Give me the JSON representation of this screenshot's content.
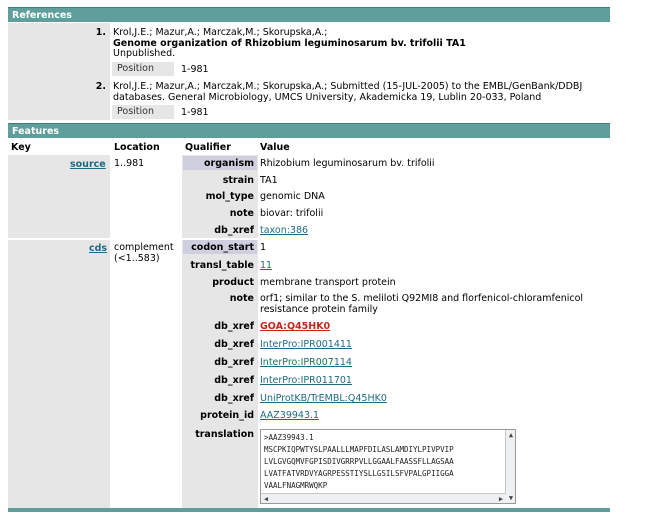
{
  "references": {
    "header": "References",
    "items": [
      {
        "num": "1.",
        "authors": "Krol,J.E.; Mazur,A.; Marczak,M.; Skorupska,A.;",
        "title": "Genome organization of Rhizobium leguminosarum bv. trifolii TA1",
        "journal": "Unpublished.",
        "position_label": "Position",
        "position_value": "1-981"
      },
      {
        "num": "2.",
        "line1": "Krol,J.E.; Mazur,A.; Marczak,M.; Skorupska,A.; Submitted (15-JUL-2005) to the EMBL/GenBank/DDBJ",
        "line2": "databases. General Microbiology, UMCS University, Akademicka 19, Lublin 20-033, Poland",
        "position_label": "Position",
        "position_value": "1-981"
      }
    ]
  },
  "features": {
    "header": "Features",
    "columns": {
      "key": "Key",
      "location": "Location",
      "qualifier": "Qualifier",
      "value": "Value"
    },
    "source": {
      "key": "source",
      "location": "1..981",
      "rows": [
        {
          "q": "organism",
          "v": "Rhizobium leguminosarum bv. trifolii"
        },
        {
          "q": "strain",
          "v": "TA1"
        },
        {
          "q": "mol_type",
          "v": "genomic DNA"
        },
        {
          "q": "note",
          "v": "biovar: trifolii"
        },
        {
          "q": "db_xref",
          "v": "taxon:386"
        }
      ]
    },
    "cds": {
      "key": "cds",
      "location1": "complement",
      "location2": "(<1..583)",
      "rows": [
        {
          "q": "codon_start",
          "v": "1"
        },
        {
          "q": "transl_table",
          "v": "11"
        },
        {
          "q": "product",
          "v": "membrane transport protein"
        },
        {
          "q": "note",
          "v1": "orf1; similar to the S. meliloti Q92MI8 and florfenicol-chloramfenicol",
          "v2": "resistance protein family"
        },
        {
          "q": "db_xref",
          "v": "GOA:Q45HK0"
        },
        {
          "q": "db_xref",
          "v": "InterPro:IPR001411"
        },
        {
          "q": "db_xref",
          "v": "InterPro:IPR007114"
        },
        {
          "q": "db_xref",
          "v": "InterPro:IPR011701"
        },
        {
          "q": "db_xref",
          "v": "UniProtKB/TrEMBL:Q45HK0"
        },
        {
          "q": "protein_id",
          "v": "AAZ39943.1"
        },
        {
          "q": "translation"
        }
      ],
      "translation_lines": [
        ">AAZ39943.1",
        "MSCPKIQPWTYSLPAALLLMAPFDILASLAMDIYLPIVPVIP",
        "LVLGVGQMVFGPISDIVGRRPVLLGGAALFAASSFLLAGSAA",
        "LVATFATVRDVYAGRPESSTIYSLLGSILSFVPALGPIIGGA",
        "VAALFNAGMRWQKP"
      ]
    }
  }
}
